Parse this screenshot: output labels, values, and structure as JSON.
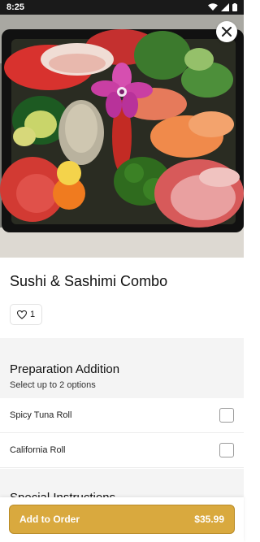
{
  "status_bar": {
    "time": "8:25"
  },
  "hero": {
    "alt_icon": "close-icon"
  },
  "item": {
    "title": "Sushi & Sashimi Combo",
    "like_count": "1"
  },
  "section": {
    "title": "Preparation Addition",
    "subtitle": "Select up to 2 options",
    "options": [
      {
        "label": "Spicy Tuna Roll",
        "checked": false
      },
      {
        "label": "California Roll",
        "checked": false
      }
    ]
  },
  "next_section": {
    "title": "Special Instructions"
  },
  "footer": {
    "button_label": "Add to Order",
    "price": "$35.99"
  },
  "colors": {
    "accent": "#d9a93e",
    "status_bar": "#1a1a1a",
    "section_bg": "#f4f4f4"
  }
}
